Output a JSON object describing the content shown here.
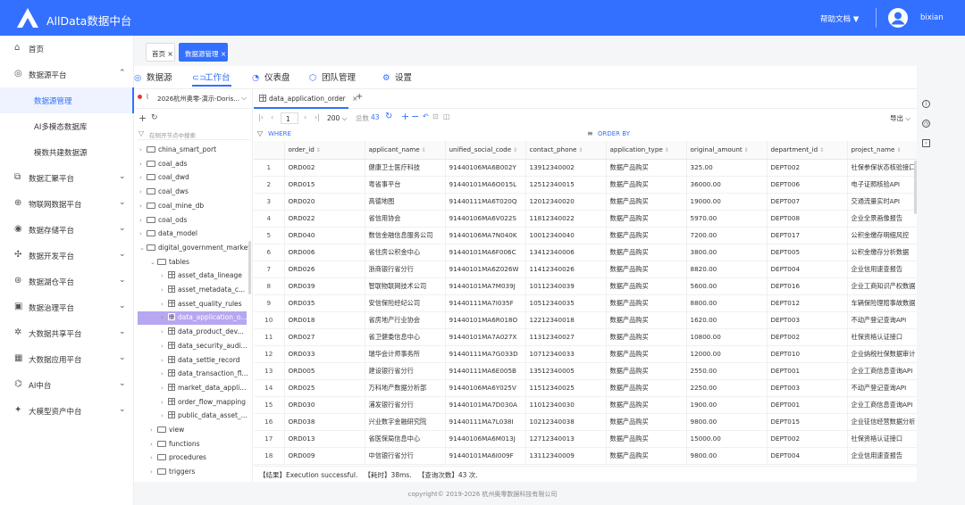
{
  "app": {
    "title": "AllData数据中台",
    "help_label": "帮助文档 ▼",
    "user": "bixian"
  },
  "sidebar": {
    "items": [
      {
        "icon": "home-icon",
        "label": "首页",
        "chev": ""
      },
      {
        "icon": "database-icon",
        "label": "数据源平台",
        "chev": "⌃"
      },
      {
        "icon": "",
        "label": "数据源管理",
        "chev": ""
      },
      {
        "icon": "",
        "label": "AI多模态数据库",
        "chev": ""
      },
      {
        "icon": "",
        "label": "模数共建数据源",
        "chev": ""
      },
      {
        "icon": "converge-icon",
        "label": "数据汇聚平台",
        "chev": "⌄"
      },
      {
        "icon": "network-icon",
        "label": "物联网数据平台",
        "chev": "⌄"
      },
      {
        "icon": "storage-icon",
        "label": "数据存储平台",
        "chev": "⌄"
      },
      {
        "icon": "dev-icon",
        "label": "数据开发平台",
        "chev": "⌄"
      },
      {
        "icon": "lake-icon",
        "label": "数据湖仓平台",
        "chev": "⌄"
      },
      {
        "icon": "governance-icon",
        "label": "数据治理平台",
        "chev": "⌄"
      },
      {
        "icon": "share-icon",
        "label": "大数据共享平台",
        "chev": "⌄"
      },
      {
        "icon": "application-icon",
        "label": "大数据应用平台",
        "chev": "⌄"
      },
      {
        "icon": "ai-icon",
        "label": "AI中台",
        "chev": "⌄"
      },
      {
        "icon": "model-icon",
        "label": "大模型资产中台",
        "chev": "⌄"
      }
    ]
  },
  "page_tabs": [
    {
      "label": "首页",
      "close": "×"
    },
    {
      "label": "数据源管理",
      "close": "×"
    }
  ],
  "main_tabs": [
    "数据源",
    "工作台",
    "仪表盘",
    "团队管理",
    "设置"
  ],
  "connection": {
    "label": "2026杭州奥零-演示-Doris...",
    "chev": "⌵"
  },
  "tree": {
    "search_placeholder": "在侧开节点中搜索",
    "nodes": [
      {
        "label": "china_smart_port",
        "type": "db"
      },
      {
        "label": "coal_ads",
        "type": "db"
      },
      {
        "label": "coal_dwd",
        "type": "db"
      },
      {
        "label": "coal_dws",
        "type": "db"
      },
      {
        "label": "coal_mine_db",
        "type": "db"
      },
      {
        "label": "coal_ods",
        "type": "db"
      },
      {
        "label": "data_model",
        "type": "db"
      },
      {
        "label": "digital_government_market",
        "type": "db-open"
      },
      {
        "label": "tables",
        "type": "folder-open"
      },
      {
        "label": "asset_data_lineage",
        "type": "table"
      },
      {
        "label": "asset_metadata_c...",
        "type": "table"
      },
      {
        "label": "asset_quality_rules",
        "type": "table"
      },
      {
        "label": "data_application_o...",
        "type": "table-sel"
      },
      {
        "label": "data_product_dev...",
        "type": "table"
      },
      {
        "label": "data_security_audi...",
        "type": "table"
      },
      {
        "label": "data_settle_record",
        "type": "table"
      },
      {
        "label": "data_transaction_fl...",
        "type": "table"
      },
      {
        "label": "market_data_appli...",
        "type": "table"
      },
      {
        "label": "order_flow_mapping",
        "type": "table"
      },
      {
        "label": "public_data_asset_...",
        "type": "table"
      },
      {
        "label": "view",
        "type": "folder"
      },
      {
        "label": "functions",
        "type": "folder"
      },
      {
        "label": "procedures",
        "type": "folder"
      },
      {
        "label": "triggers",
        "type": "folder"
      }
    ]
  },
  "query_tab": {
    "label": "data_application_order",
    "close": "×",
    "add": "+"
  },
  "toolbar": {
    "page": "1",
    "page_size": "200 ⌵",
    "total_label": "总数",
    "total": "43",
    "export": "导出 ⌵"
  },
  "filter": {
    "where": "WHERE",
    "order_by": "ORDER BY"
  },
  "grid": {
    "columns": [
      "",
      "order_id",
      "applicant_name",
      "unified_social_code",
      "contact_phone",
      "application_type",
      "original_amount",
      "department_id",
      "project_name"
    ],
    "rows": [
      [
        "1",
        "ORD002",
        "健康卫士医疗科技",
        "91440106MA6B002Y",
        "13912340002",
        "数据产品购买",
        "325.00",
        "DEPT002",
        "社保参保状态核验接口"
      ],
      [
        "2",
        "ORD015",
        "粤省事平台",
        "91440101MA6O015L",
        "12512340015",
        "数据产品购买",
        "36000.00",
        "DEPT006",
        "电子证照核验API"
      ],
      [
        "3",
        "ORD020",
        "高德地图",
        "91440111MA6T020Q",
        "12012340020",
        "数据产品购买",
        "19000.00",
        "DEPT007",
        "交通流量实时API"
      ],
      [
        "4",
        "ORD022",
        "省信用协会",
        "91440106MA6V022S",
        "11812340022",
        "数据产品购买",
        "5970.00",
        "DEPT008",
        "企业全景画像报告"
      ],
      [
        "5",
        "ORD040",
        "数信金融信息服务公司",
        "91440106MA7N040K",
        "10012340040",
        "数据产品购买",
        "7200.00",
        "DEPT017",
        "公积金缴存明细风控"
      ],
      [
        "6",
        "ORD006",
        "省住房公积金中心",
        "91440101MA6F006C",
        "13412340006",
        "数据产品购买",
        "3800.00",
        "DEPT005",
        "公积金缴存分析数据"
      ],
      [
        "7",
        "ORD026",
        "浙商银行省分行",
        "91440101MA6Z026W",
        "11412340026",
        "数据产品购买",
        "8820.00",
        "DEPT004",
        "企业信用速查报告"
      ],
      [
        "8",
        "ORD039",
        "智联物联网技术公司",
        "91440101MA7M039J",
        "10112340039",
        "数据产品购买",
        "5600.00",
        "DEPT016",
        "企业工商知识产权数据"
      ],
      [
        "9",
        "ORD035",
        "安信保险经纪公司",
        "91440111MA7I035F",
        "10512340035",
        "数据产品购买",
        "8800.00",
        "DEPT012",
        "车辆保险理赔事故数据"
      ],
      [
        "10",
        "ORD018",
        "省房地产行业协会",
        "91440101MA6R018O",
        "12212340018",
        "数据产品购买",
        "1620.00",
        "DEPT003",
        "不动产登记查询API"
      ],
      [
        "11",
        "ORD027",
        "省卫健委信息中心",
        "91440101MA7A027X",
        "11312340027",
        "数据产品购买",
        "10800.00",
        "DEPT002",
        "社保资格认证接口"
      ],
      [
        "12",
        "ORD033",
        "瑞华会计师事务所",
        "91440111MA7G033D",
        "10712340033",
        "数据产品购买",
        "12000.00",
        "DEPT010",
        "企业纳税社保数据审计"
      ],
      [
        "13",
        "ORD005",
        "建设银行省分行",
        "91440111MA6E005B",
        "13512340005",
        "数据产品购买",
        "2550.00",
        "DEPT001",
        "企业工商信息查询API"
      ],
      [
        "14",
        "ORD025",
        "万科地产数据分析部",
        "91440106MA6Y025V",
        "11512340025",
        "数据产品购买",
        "2250.00",
        "DEPT003",
        "不动产登记查询API"
      ],
      [
        "15",
        "ORD030",
        "浦发银行省分行",
        "91440101MA7D030A",
        "11012340030",
        "数据产品购买",
        "1900.00",
        "DEPT001",
        "企业工商信息查询API"
      ],
      [
        "16",
        "ORD038",
        "兴业数字金融研究院",
        "91440111MA7L038I",
        "10212340038",
        "数据产品购买",
        "9800.00",
        "DEPT015",
        "企业征信经营数据分析"
      ],
      [
        "17",
        "ORD013",
        "省医保局信息中心",
        "91440106MA6M013J",
        "12712340013",
        "数据产品购买",
        "15000.00",
        "DEPT002",
        "社保资格认证接口"
      ],
      [
        "18",
        "ORD009",
        "中信银行省分行",
        "91440101MA6I009F",
        "13112340009",
        "数据产品购买",
        "9800.00",
        "DEPT004",
        "企业信用速查报告"
      ]
    ]
  },
  "status": {
    "result": "【结果】Execution successful.",
    "time": "【耗时】38ms.",
    "count": "【查询次数】43 次."
  },
  "footer": "copyright© 2019-2026 杭州奥零数据科技有限公司"
}
